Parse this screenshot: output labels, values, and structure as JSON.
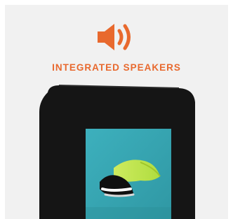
{
  "feature": {
    "title": "INTEGRATED SPEAKERS",
    "icon": "speaker-volume-icon",
    "accent_color": "#e8692e"
  },
  "device": {
    "icon": "digital-signage-kiosk-image",
    "frame_color": "#151515",
    "screen_color": "#3aa9b6"
  },
  "background_color": "#f1f1f1"
}
